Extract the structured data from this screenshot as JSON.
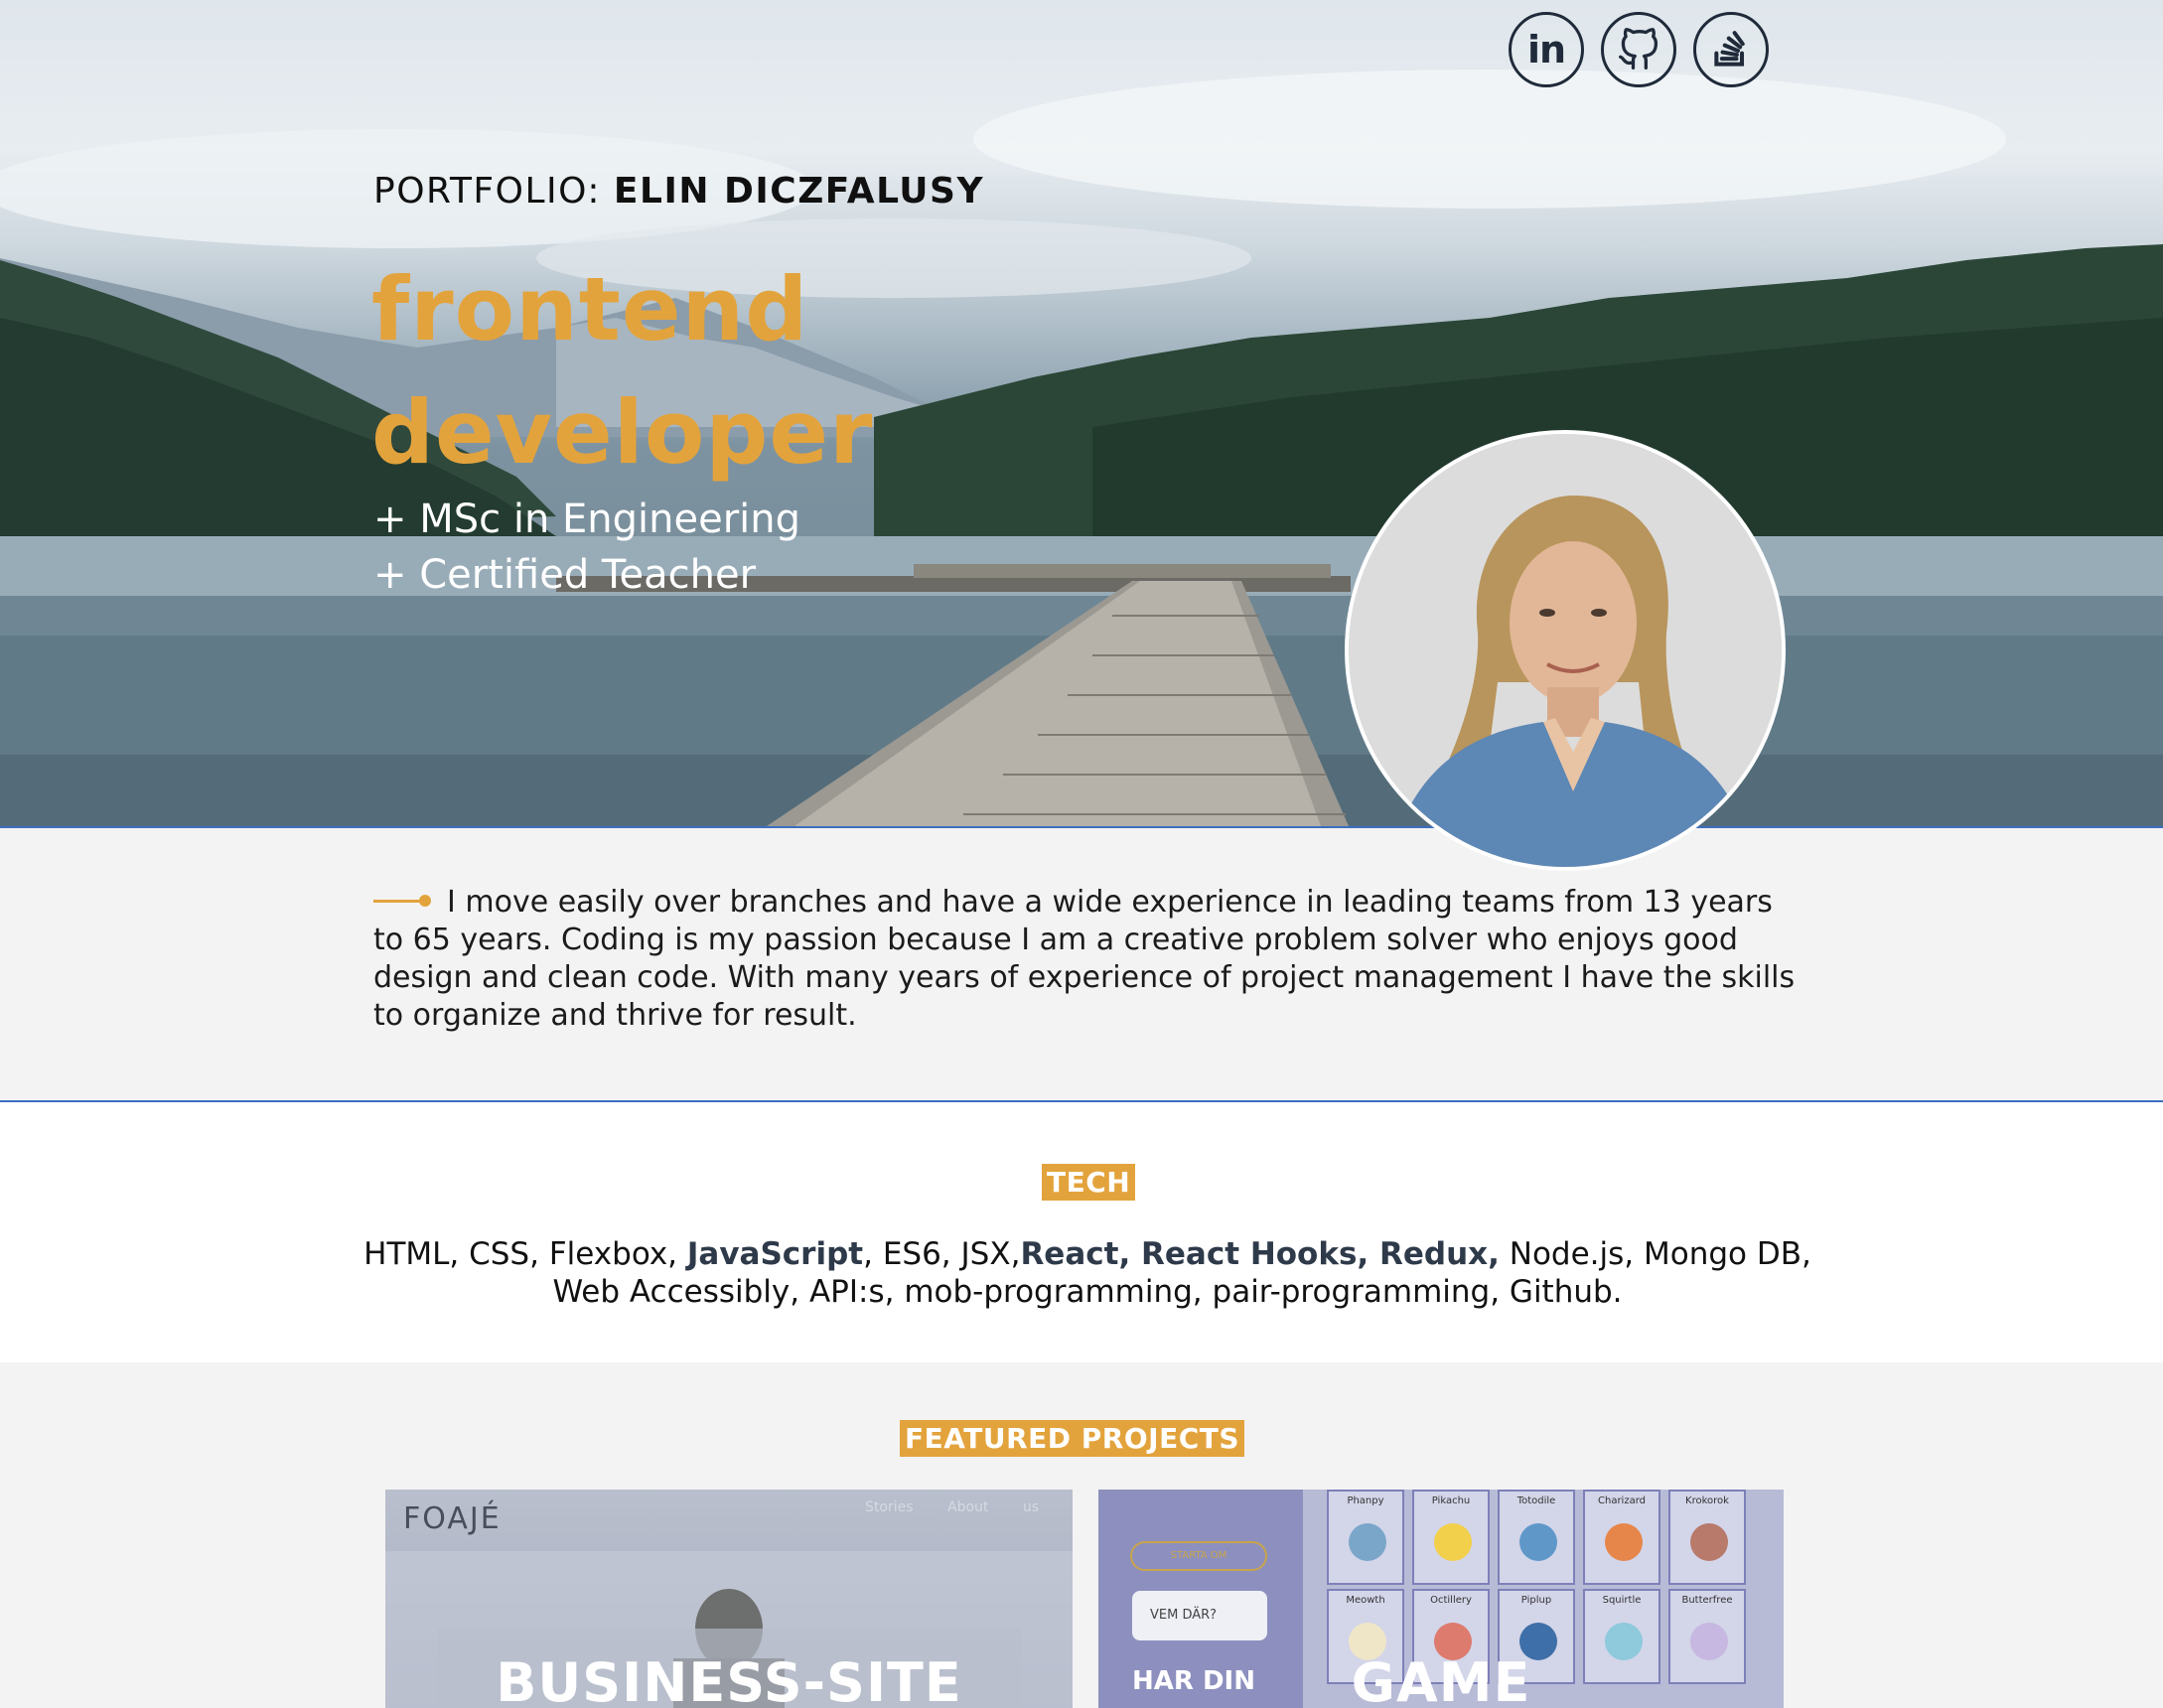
{
  "social": [
    {
      "name": "linkedin-icon",
      "label": "in"
    },
    {
      "name": "github-icon",
      "label": ""
    },
    {
      "name": "stackoverflow-icon",
      "label": ""
    }
  ],
  "hero": {
    "prefix": "PORTFOLIO: ",
    "name": "ELIN DICZFALUSY",
    "title_line1": "frontend",
    "title_line2": "developer",
    "sub_line1": "+ MSc in Engineering",
    "sub_line2": "+ Certified Teacher"
  },
  "about": {
    "text": "I move easily over branches and have a wide experience in leading teams from 13 years to 65 years. Coding is my passion because I am a creative problem solver who enjoys good design and clean code. With many years of experience of project management I have the skills to organize and thrive for result."
  },
  "tech": {
    "heading": "TECH",
    "t1": "HTML, CSS, Flexbox, ",
    "b1": "JavaScript",
    "t2": ", ES6, JSX,",
    "b2": "React, React Hooks, Redux,",
    "t3": " Node.js, Mongo DB, Web Accessibly, API:s, mob-programming, pair-programming, Github."
  },
  "projects": {
    "heading": "FEATURED PROJECTS",
    "cards": [
      {
        "label": "BUSINESS-SITE",
        "logo": "FOAJÉ",
        "nav": "Stories About us"
      },
      {
        "label": "GAME",
        "start": "STARTA OM",
        "bubble": "VEM DÄR?",
        "side_text": "HAR DIN",
        "pokemon": [
          "Phanpy",
          "Pikachu",
          "Totodile",
          "Charizard",
          "Krokorok",
          "Meowth",
          "Octillery",
          "Piplup",
          "Squirtle",
          "Butterfree"
        ]
      }
    ]
  },
  "colors": {
    "accent": "#e3a33c",
    "divider": "#3d6fc2",
    "dark": "#1f2a3a"
  }
}
